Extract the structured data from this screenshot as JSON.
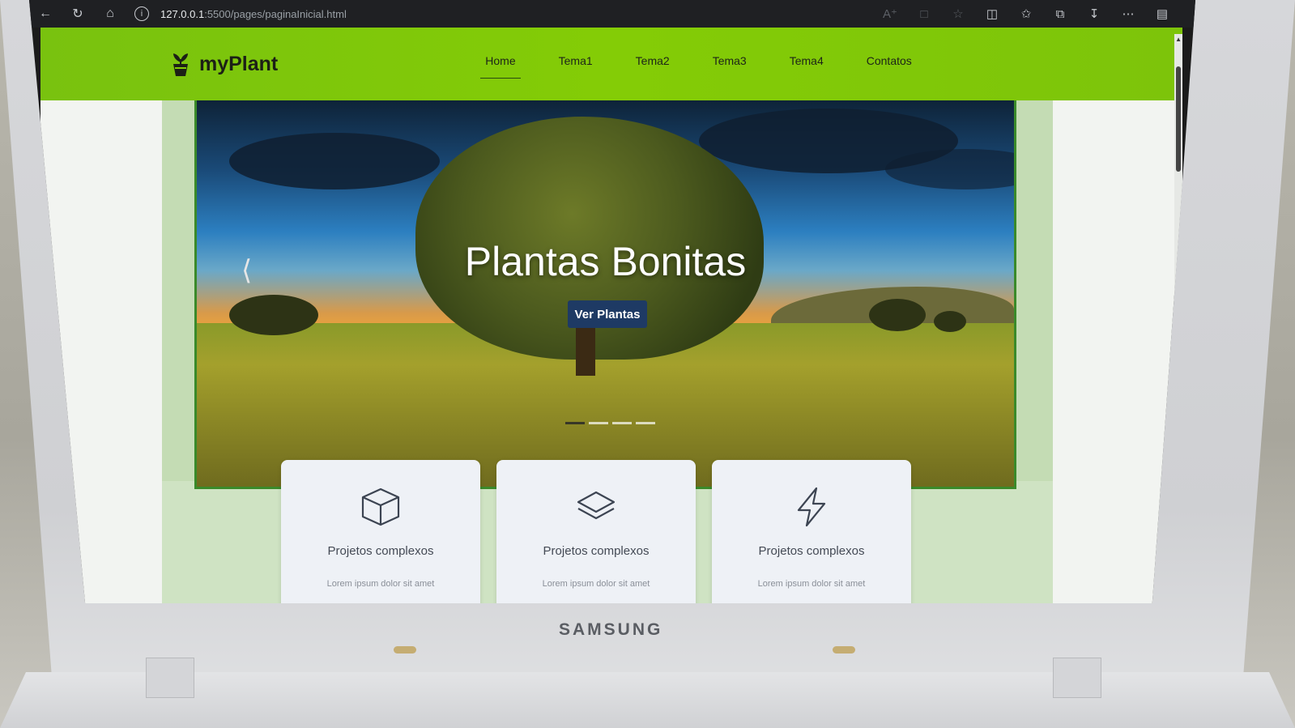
{
  "browser": {
    "url_host": "127.0.0.1",
    "url_path": ":5500/pages/paginaInicial.html"
  },
  "site": {
    "brand": "myPlant",
    "nav": [
      "Home",
      "Tema1",
      "Tema2",
      "Tema3",
      "Tema4",
      "Contatos"
    ],
    "active_nav": "Home"
  },
  "hero": {
    "title": "Plantas Bonitas",
    "button": "Ver Plantas",
    "slide_count": 4,
    "active_slide": 1
  },
  "cards": [
    {
      "icon": "box-icon",
      "title": "Projetos complexos",
      "text": "Lorem ipsum dolor sit amet"
    },
    {
      "icon": "layers-icon",
      "title": "Projetos complexos",
      "text": "Lorem ipsum dolor sit amet"
    },
    {
      "icon": "lightning-icon",
      "title": "Projetos complexos",
      "text": "Lorem ipsum dolor sit amet"
    }
  ],
  "laptop": {
    "brand": "SAMSUNG"
  },
  "colors": {
    "navbar": "#84cc06",
    "hero_button": "#1e3a64",
    "side_panel": "#c4dcb4"
  }
}
